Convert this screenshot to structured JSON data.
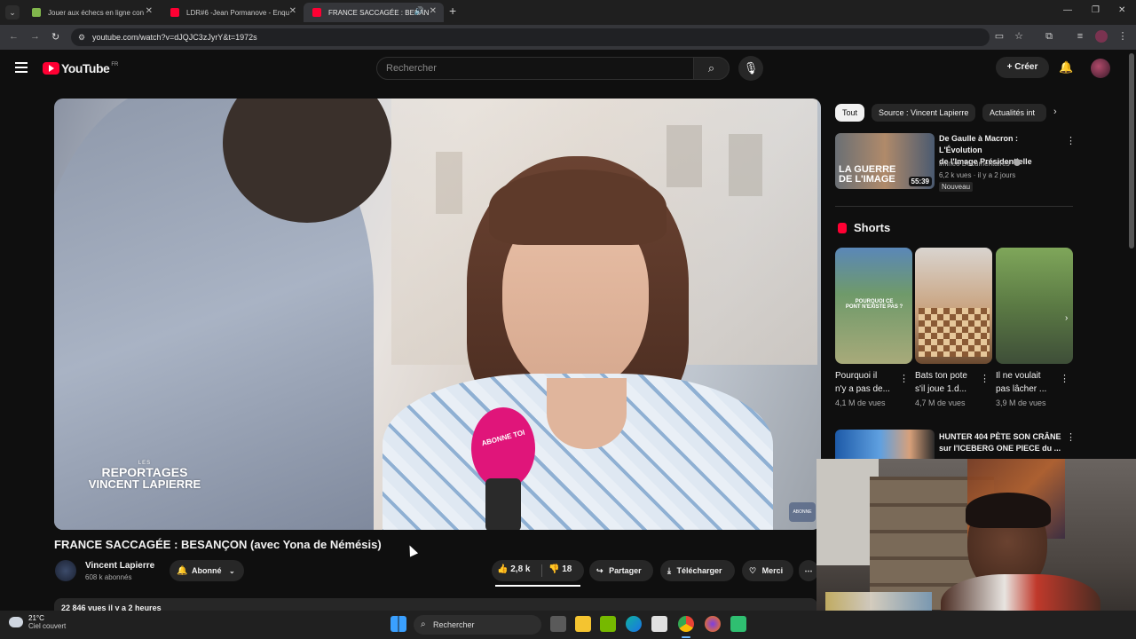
{
  "browser": {
    "tabs": [
      {
        "title": "Jouer aux échecs en ligne con",
        "fav_color": "#81b64c"
      },
      {
        "title": "LDR#6 -Jean Pormanove - Enqu",
        "fav_color": "#ff0033"
      },
      {
        "title": "FRANCE SACCAGÉE : BESAN",
        "fav_color": "#ff0033"
      }
    ],
    "url": "youtube.com/watch?v=dJQJC3zJyrY&t=1972s"
  },
  "header": {
    "logo_text": "YouTube",
    "country": "FR",
    "search_placeholder": "Rechercher",
    "create_label": "Créer"
  },
  "video": {
    "title": "FRANCE SACCAGÉE : BESANÇON (avec Yona de Némésis)",
    "watermark_line1": "LES",
    "watermark_line2": "REPORTAGES",
    "watermark_line3": "VINCENT LAPIERRE",
    "mic_text": "ABONNE TOI",
    "corner_text": "ABONNE"
  },
  "channel": {
    "name": "Vincent Lapierre",
    "subscribers": "608 k abonnés",
    "subscribe_label": "Abonné"
  },
  "actions": {
    "likes": "2,8 k",
    "dislikes": "18",
    "share": "Partager",
    "download": "Télécharger",
    "thanks": "Merci"
  },
  "description_partial": "22 846 vues  il y a 2 heures",
  "sidebar": {
    "chips": [
      "Tout",
      "Source : Vincent Lapierre",
      "Actualités int"
    ],
    "rec1": {
      "title_line1": "De Gaulle à Macron : L'Évolution",
      "title_line2": "de l'Image Présidentielle",
      "channel": "imineo Documentaires",
      "meta": "6,2 k vues · il y a 2 jours",
      "badge": "Nouveau",
      "duration": "55:39",
      "thumb_text1": "LA GUERRE",
      "thumb_text2": "DE L'IMAGE"
    },
    "shorts_title": "Shorts",
    "shorts": [
      {
        "title1": "Pourquoi il",
        "title2": "n'y a pas de...",
        "views": "4,1 M de vues",
        "overlay1": "POURQUOI CE",
        "overlay2": "PONT N'EXISTE PAS ?"
      },
      {
        "title1": "Bats ton pote",
        "title2": "s'il joue 1.d...",
        "views": "4,7 M de vues"
      },
      {
        "title1": "Il ne voulait",
        "title2": "pas lâcher ...",
        "views": "3,9 M de vues"
      }
    ],
    "rec2": {
      "title_line1": "HUNTER 404 PÈTE SON CRÂNE",
      "title_line2": "sur l'ICEBERG ONE PIECE du ..."
    }
  },
  "taskbar": {
    "temp": "21°C",
    "weather": "Ciel couvert",
    "search": "Rechercher"
  },
  "colors": {
    "bg": "#0f0f0f",
    "brand_red": "#ff0033",
    "mic_pink": "#e0157a"
  }
}
